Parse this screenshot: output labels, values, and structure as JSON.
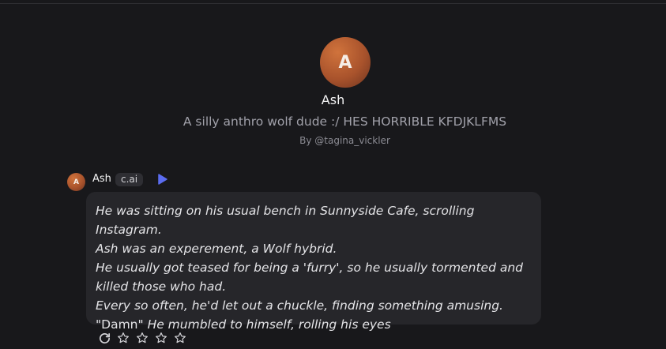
{
  "character": {
    "avatar_initial": "A",
    "name": "Ash",
    "tagline": "A silly anthro wolf dude :/ HES HORRIBLE KFDJKLFMS",
    "byline": "By @tagina_vickler"
  },
  "message": {
    "avatar_initial": "A",
    "sender": "Ash",
    "badge": "c.ai",
    "lines": [
      {
        "italic": "He was sitting on his usual bench in Sunnyside Cafe, scrolling Instagram."
      },
      {
        "italic": "Ash was an experement, a Wolf hybrid."
      },
      {
        "italic": "He usually got teased for being a 'furry', so he usually tormented and killed those who had."
      },
      {
        "italic": "Every so often, he'd let out  a chuckle, finding something amusing."
      },
      {
        "quote": "\"Damn\"",
        "italic": "He mumbled to himself, rolling his eyes"
      }
    ]
  },
  "actions": {
    "icons": [
      "refresh-icon",
      "star-icon",
      "star-icon",
      "star-icon",
      "star-icon"
    ],
    "rating": 0,
    "rating_max": 4
  },
  "colors": {
    "background": "#18181b",
    "bubble": "#26262a",
    "play_accent": "#5b6cf0",
    "avatar": "#b85a30"
  }
}
